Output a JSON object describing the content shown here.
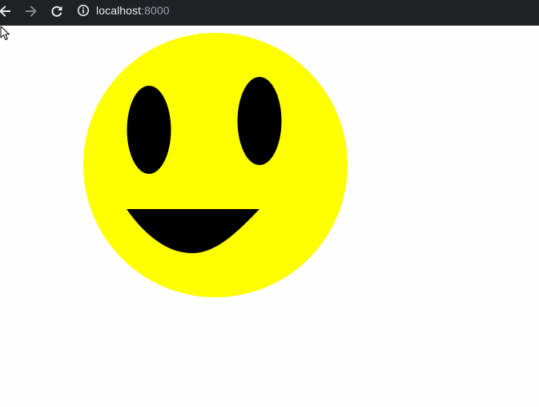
{
  "browser": {
    "back_icon": "arrow-left-icon",
    "forward_icon": "arrow-right-icon",
    "reload_icon": "reload-icon",
    "info_icon": "info-icon",
    "url_host": "localhost",
    "url_port": ":8000",
    "colors": {
      "toolbar": "#202124",
      "icon_active": "#e8eaed",
      "icon_disabled": "#80868b"
    }
  },
  "page": {
    "background": "#ffffff",
    "smiley": {
      "face_color": "#ffff00",
      "feature_color": "#000000"
    },
    "cursor_icon": "mouse-pointer-icon"
  }
}
